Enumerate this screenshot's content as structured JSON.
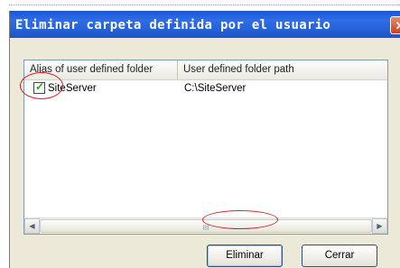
{
  "dialog": {
    "title": "Eliminar carpeta definida por el usuario",
    "close_glyph": "✕"
  },
  "list": {
    "columns": [
      "Alias of user defined folder",
      "User defined folder path"
    ],
    "rows": [
      {
        "checked": true,
        "alias": "SiteServer",
        "path": "C:\\SiteServer"
      }
    ],
    "scroll_grip": "III"
  },
  "buttons": {
    "eliminar": "Eliminar",
    "cerrar": "Cerrar"
  },
  "icons": {
    "close": "close-icon",
    "scroll_left": "chevron-left-icon",
    "scroll_right": "chevron-right-icon",
    "check": "checkmark-icon"
  }
}
